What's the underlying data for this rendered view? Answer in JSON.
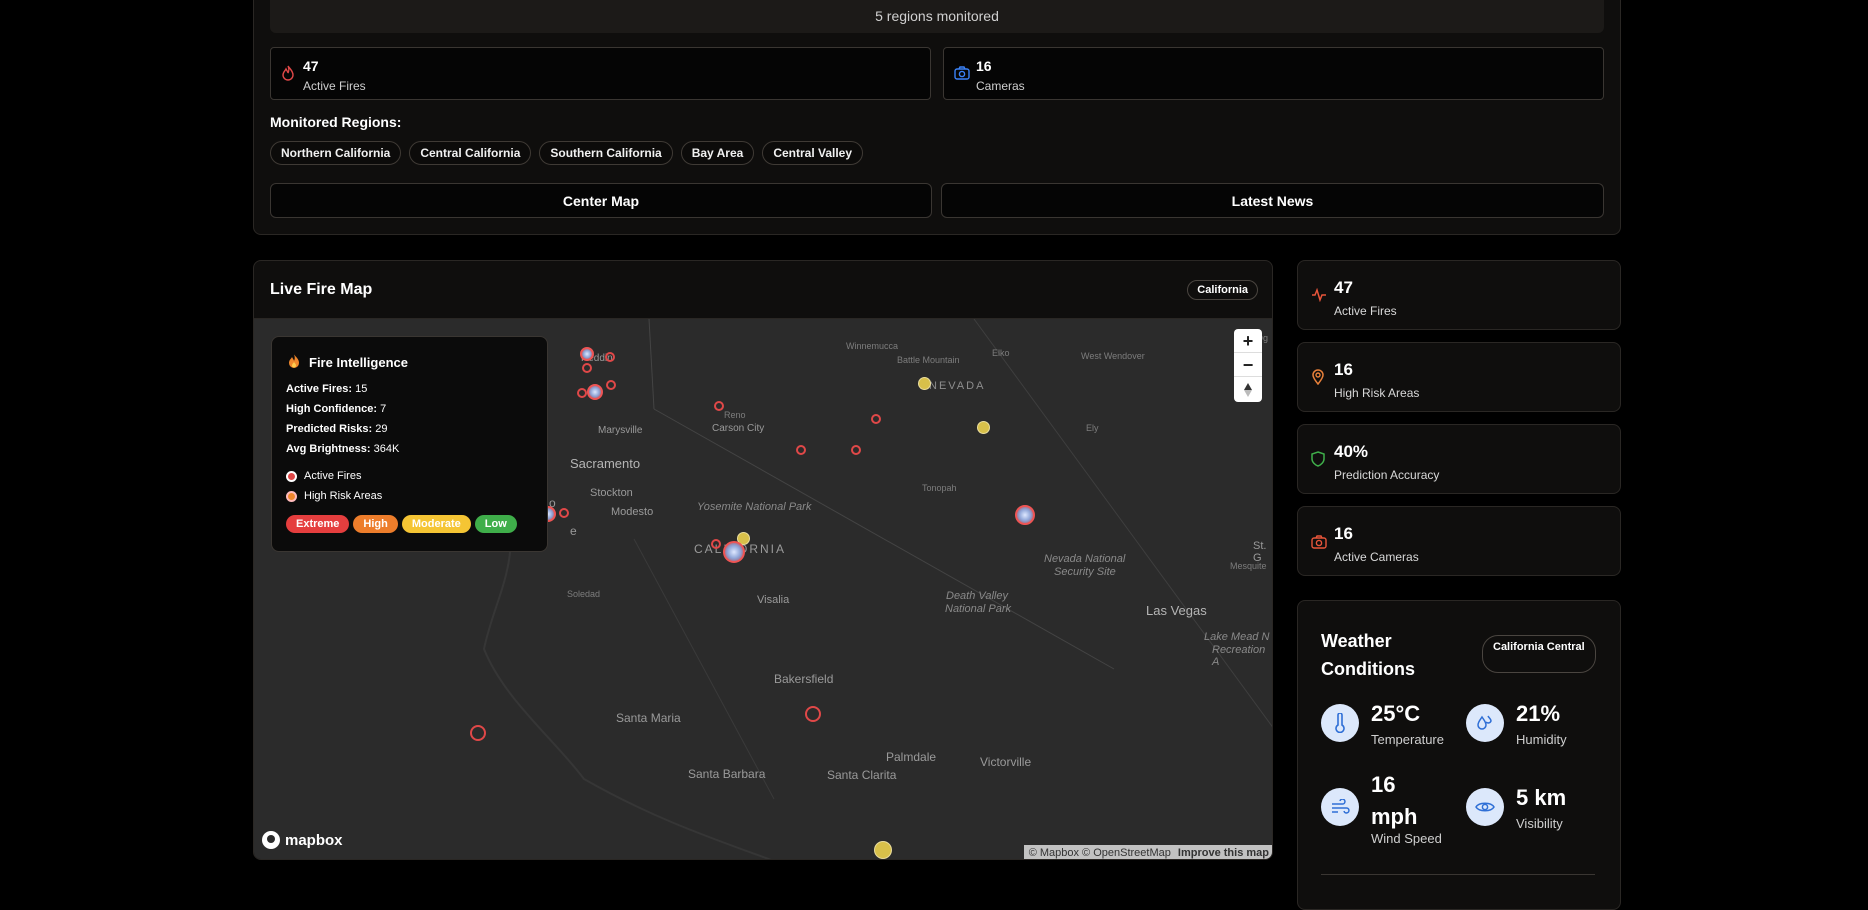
{
  "top": {
    "regions_monitored": "5 regions monitored",
    "stats": [
      {
        "value": "47",
        "label": "Active Fires",
        "icon": "flame-icon"
      },
      {
        "value": "16",
        "label": "Cameras",
        "icon": "camera-icon"
      }
    ],
    "monitored_title": "Monitored Regions:",
    "regions": [
      "Northern California",
      "Central California",
      "Southern California",
      "Bay Area",
      "Central Valley"
    ],
    "center_map": "Center Map",
    "latest_news": "Latest News"
  },
  "map": {
    "title": "Live Fire Map",
    "badge": "California",
    "zoom_in": "+",
    "zoom_out": "−",
    "attribution": "© Mapbox © OpenStreetMap",
    "improve": "Improve this map",
    "logo": "mapbox",
    "labels": {
      "winnemucca": "Winnemucca",
      "battle_mountain": "Battle Mountain",
      "elko": "Elko",
      "west_wendover": "West Wendover",
      "nevada": "NEVADA",
      "ogden": "Og",
      "reno": "Reno",
      "carson_city": "Carson City",
      "ely": "Ely",
      "redding": "Reddin",
      "marysville": "Marysville",
      "sacramento": "Sacramento",
      "stockton": "Stockton",
      "modesto": "Modesto",
      "yosemite": "Yosemite National Park",
      "tonopah": "Tonopah",
      "california": "CALIFORNIA",
      "nevada_ns": "Nevada National",
      "security_site": "Security Site",
      "st_g": "St. G",
      "mesquite": "Mesquite",
      "soledad": "Soledad",
      "visalia": "Visalia",
      "death_valley_1": "Death Valley",
      "death_valley_2": "National Park",
      "las_vegas": "Las Vegas",
      "lake_mead_1": "Lake Mead N",
      "lake_mead_2": "Recreation A",
      "bakersfield": "Bakersfield",
      "santa_maria": "Santa Maria",
      "palmdale": "Palmdale",
      "victorville": "Victorville",
      "santa_barbara": "Santa Barbara",
      "santa_clarita": "Santa Clarita",
      "o_partial": "o",
      "e_partial": "e"
    },
    "intel": {
      "title": "Fire Intelligence",
      "rows": [
        {
          "label": "Active Fires:",
          "value": "15"
        },
        {
          "label": "High Confidence:",
          "value": "7"
        },
        {
          "label": "Predicted Risks:",
          "value": "29"
        },
        {
          "label": "Avg Brightness:",
          "value": "364K"
        }
      ],
      "legend": [
        {
          "label": "Active Fires",
          "color": "#e04848"
        },
        {
          "label": "High Risk Areas",
          "color": "#f0872c"
        }
      ],
      "levels": [
        {
          "label": "Extreme",
          "color": "#e53e3e"
        },
        {
          "label": "High",
          "color": "#ed7d2b"
        },
        {
          "label": "Moderate",
          "color": "#f5c534"
        },
        {
          "label": "Low",
          "color": "#3fae4a"
        }
      ]
    }
  },
  "right_stats": [
    {
      "value": "47",
      "label": "Active Fires",
      "icon": "activity-icon",
      "color": "#e8553a"
    },
    {
      "value": "16",
      "label": "High Risk Areas",
      "icon": "map-pin-icon",
      "color": "#e8803a"
    },
    {
      "value": "40%",
      "label": "Prediction Accuracy",
      "icon": "shield-icon",
      "color": "#3fae4a"
    },
    {
      "value": "16",
      "label": "Active Cameras",
      "icon": "camera-icon",
      "color": "#e8553a"
    }
  ],
  "weather": {
    "title": "Weather Conditions",
    "location": "California Central",
    "items": [
      {
        "value": "25°C",
        "label": "Temperature",
        "icon": "thermometer-icon"
      },
      {
        "value": "21%",
        "label": "Humidity",
        "icon": "droplets-icon"
      },
      {
        "value": "16 mph",
        "label": "Wind Speed",
        "icon": "wind-icon"
      },
      {
        "value": "5 km",
        "label": "Visibility",
        "icon": "eye-icon"
      }
    ]
  },
  "colors": {
    "accent_red": "#e04848",
    "accent_orange": "#f0872c",
    "info_blue": "#3b82f6"
  }
}
